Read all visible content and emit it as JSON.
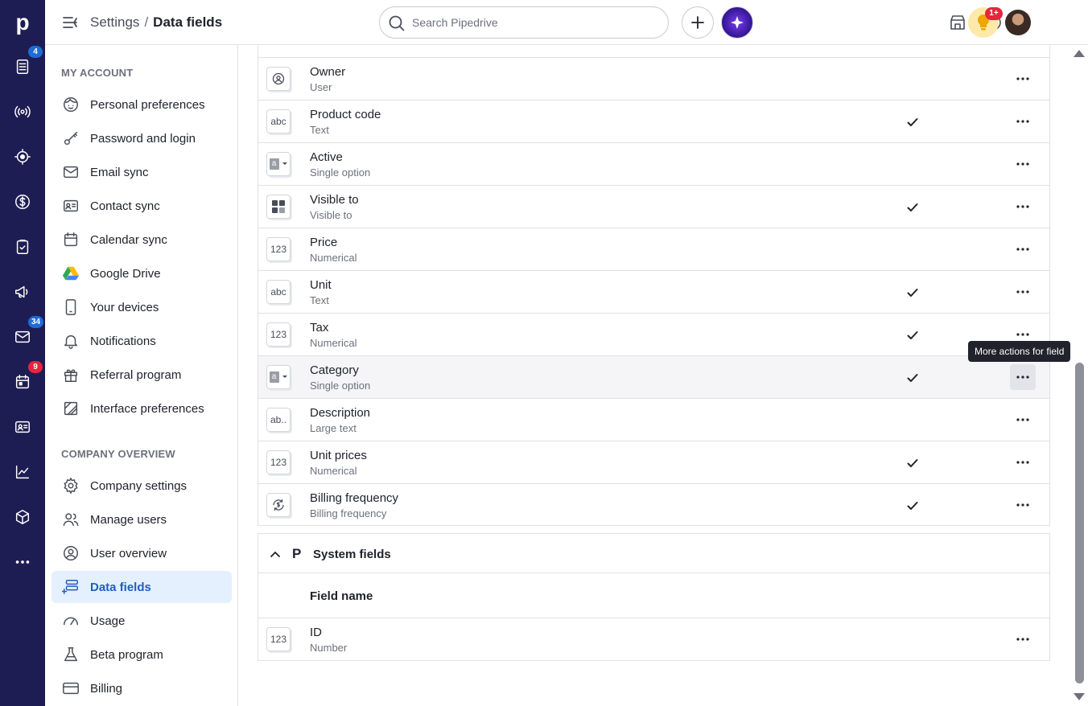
{
  "app": {
    "logo": "p",
    "breadcrumb": {
      "parent": "Settings",
      "separator": "/",
      "current": "Data fields"
    },
    "search": {
      "placeholder": "Search Pipedrive"
    },
    "notifications_badge": "1+"
  },
  "leftnav": [
    {
      "icon": "leads-icon",
      "badge": "4",
      "badge_color": "#1f6bd8"
    },
    {
      "icon": "radio-broadcast-icon"
    },
    {
      "icon": "target-icon"
    },
    {
      "icon": "deals-dollar-icon"
    },
    {
      "icon": "activities-clipboard-icon"
    },
    {
      "icon": "campaigns-megaphone-icon"
    },
    {
      "icon": "mail-icon",
      "badge": "34",
      "badge_color": "#1f6bd8"
    },
    {
      "icon": "calendar-icon",
      "badge": "9",
      "badge_color": "#e5253d"
    },
    {
      "icon": "contacts-card-icon"
    },
    {
      "icon": "insights-chart-icon"
    },
    {
      "icon": "products-box-icon"
    },
    {
      "icon": "more-icon"
    }
  ],
  "sidebar": {
    "my_account_heading": "MY ACCOUNT",
    "my_account": [
      {
        "label": "Personal preferences",
        "icon": "face-icon"
      },
      {
        "label": "Password and login",
        "icon": "key-icon"
      },
      {
        "label": "Email sync",
        "icon": "envelope-icon"
      },
      {
        "label": "Contact sync",
        "icon": "contact-card-icon"
      },
      {
        "label": "Calendar sync",
        "icon": "calendar-sync-icon"
      },
      {
        "label": "Google Drive",
        "icon": "google-drive-icon"
      },
      {
        "label": "Your devices",
        "icon": "phone-icon"
      },
      {
        "label": "Notifications",
        "icon": "bell-icon"
      },
      {
        "label": "Referral program",
        "icon": "gift-icon"
      },
      {
        "label": "Interface preferences",
        "icon": "interface-icon"
      }
    ],
    "company_heading": "COMPANY OVERVIEW",
    "company": [
      {
        "label": "Company settings",
        "icon": "gear-icon"
      },
      {
        "label": "Manage users",
        "icon": "users-icon"
      },
      {
        "label": "User overview",
        "icon": "user-circle-icon"
      },
      {
        "label": "Data fields",
        "icon": "data-fields-icon",
        "active": true
      },
      {
        "label": "Usage",
        "icon": "gauge-icon"
      },
      {
        "label": "Beta program",
        "icon": "flask-icon"
      },
      {
        "label": "Billing",
        "icon": "credit-card-icon"
      }
    ]
  },
  "fields": [
    {
      "name": "Owner",
      "type": "User",
      "icon": "user-icon",
      "checked": false
    },
    {
      "name": "Product code",
      "type": "Text",
      "icon": "text-abc-icon",
      "checked": true
    },
    {
      "name": "Active",
      "type": "Single option",
      "icon": "single-option-icon",
      "checked": false
    },
    {
      "name": "Visible to",
      "type": "Visible to",
      "icon": "visible-to-icon",
      "checked": true
    },
    {
      "name": "Price",
      "type": "Numerical",
      "icon": "numerical-icon",
      "checked": false
    },
    {
      "name": "Unit",
      "type": "Text",
      "icon": "text-abc-icon",
      "checked": true
    },
    {
      "name": "Tax",
      "type": "Numerical",
      "icon": "numerical-icon",
      "checked": true
    },
    {
      "name": "Category",
      "type": "Single option",
      "icon": "single-option-icon",
      "checked": true,
      "hover": true
    },
    {
      "name": "Description",
      "type": "Large text",
      "icon": "large-text-icon",
      "checked": false
    },
    {
      "name": "Unit prices",
      "type": "Numerical",
      "icon": "numerical-icon",
      "checked": true
    },
    {
      "name": "Billing frequency",
      "type": "Billing frequency",
      "icon": "billing-frequency-icon",
      "checked": true
    }
  ],
  "icon_text": {
    "abc": "abc",
    "num": "123",
    "large": "ab..",
    "opt": "a"
  },
  "system_fields": {
    "title": "System fields",
    "column_header": "Field name",
    "rows": [
      {
        "name": "ID",
        "type": "Number",
        "icon": "numerical-icon"
      }
    ]
  },
  "tooltip": "More actions for field"
}
